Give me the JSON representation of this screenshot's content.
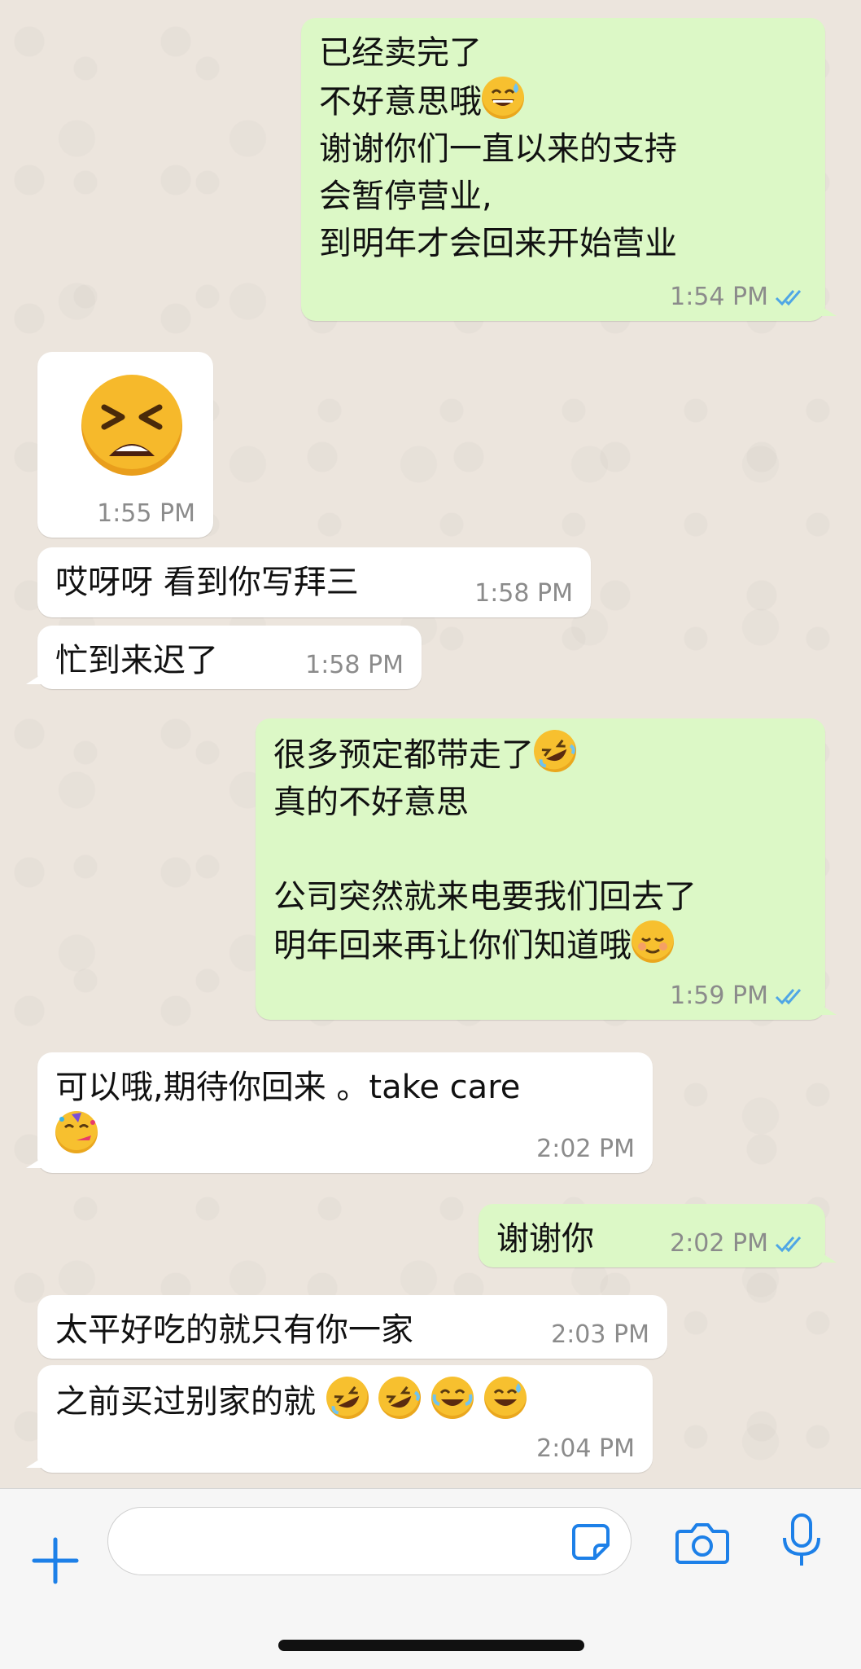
{
  "colors": {
    "outgoing_bubble": "#dcf8c6",
    "incoming_bubble": "#ffffff",
    "read_ticks": "#4fa6e5",
    "accent": "#1d80e8",
    "chat_background": "#ece5dd"
  },
  "messages": [
    {
      "id": "m1",
      "direction": "out",
      "text": "已经卖完了\n不好意思哦",
      "emoji_after": "grinning-sweat",
      "text2": "谢谢你们一直以来的支持\n会暂停营业,\n到明年才会回来开始营业",
      "time": "1:54 PM",
      "read": true
    },
    {
      "id": "m2",
      "direction": "in",
      "sticker": "tired-face-emoji",
      "time": "1:55 PM"
    },
    {
      "id": "m3",
      "direction": "in",
      "text": "哎呀呀 看到你写拜三",
      "time": "1:58 PM"
    },
    {
      "id": "m4",
      "direction": "in",
      "text": "忙到来迟了",
      "time": "1:58 PM"
    },
    {
      "id": "m5",
      "direction": "out",
      "text": "很多预定都带走了",
      "emoji_after": "rolling-laughing",
      "text2": "真的不好意思\n\n公司突然就来电要我们回去了\n明年回来再让你们知道哦",
      "emoji_after2": "smiling-blush",
      "time": "1:59 PM",
      "read": true
    },
    {
      "id": "m6",
      "direction": "in",
      "text": "可以哦,期待你回来 。take care",
      "emoji_after": "partying-face",
      "time": "2:02 PM"
    },
    {
      "id": "m7",
      "direction": "out",
      "text": "谢谢你",
      "time": "2:02 PM",
      "read": true
    },
    {
      "id": "m8",
      "direction": "in",
      "text": "太平好吃的就只有你一家",
      "time": "2:03 PM"
    },
    {
      "id": "m9",
      "direction": "in",
      "text": "之前买过别家的就 ",
      "emojis": [
        "rolling-laughing",
        "rolling-laughing",
        "tears-of-joy",
        "grinning-sweat"
      ],
      "time": "2:04 PM"
    }
  ],
  "composer": {
    "value": "",
    "icons": [
      "plus-icon",
      "sticker-icon",
      "camera-icon",
      "microphone-icon"
    ]
  }
}
